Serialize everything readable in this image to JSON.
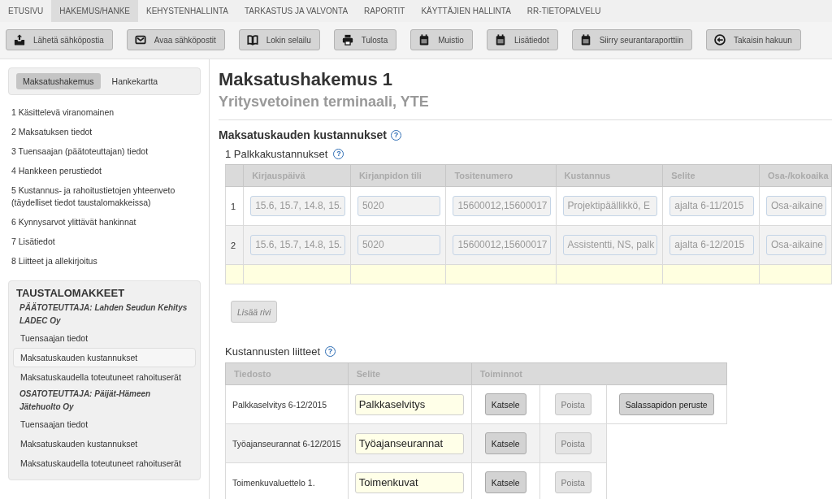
{
  "top_nav": [
    {
      "label": "ETUSIVU",
      "selected": false
    },
    {
      "label": "HAKEMUS/HANKE",
      "selected": true
    },
    {
      "label": "KEHYSTENHALLINTA",
      "selected": false
    },
    {
      "label": "TARKASTUS JA VALVONTA",
      "selected": false
    },
    {
      "label": "RAPORTIT",
      "selected": false
    },
    {
      "label": "KÄYTTÄJIEN HALLINTA",
      "selected": false
    },
    {
      "label": "RR-TIETOPALVELU",
      "selected": false
    }
  ],
  "toolbar": [
    {
      "label": "Lähetä sähköpostia",
      "kind": "send"
    },
    {
      "label": "Avaa sähköpostit",
      "kind": "mail"
    },
    {
      "label": "Lokin selailu",
      "kind": "book"
    },
    {
      "label": "Tulosta",
      "kind": "print"
    },
    {
      "label": "Muistio",
      "kind": "note"
    },
    {
      "label": "Lisätiedot",
      "kind": "note"
    },
    {
      "label": "Siirry seurantaraporttiin",
      "kind": "note"
    },
    {
      "label": "Takaisin hakuun",
      "kind": "back"
    }
  ],
  "sidebar": {
    "tabs": [
      {
        "label": "Maksatushakemus",
        "selected": true
      },
      {
        "label": "Hankekartta",
        "selected": false
      }
    ],
    "items": [
      "1 Käsittelevä viranomainen",
      "2 Maksatuksen tiedot",
      "3 Tuensaajan (päätoteuttajan) tiedot",
      "4 Hankkeen perustiedot",
      "5 Kustannus- ja rahoitustietojen yhteenveto (täydelliset tiedot taustalomakkeissa)",
      "6 Kynnysarvot ylittävät hankinnat",
      "7 Lisätiedot",
      "8 Liitteet ja allekirjoitus"
    ],
    "background_forms": {
      "title": "TAUSTALOMAKKEET",
      "groups": [
        {
          "heading": "PÄÄTOTEUTTAJA: Lahden Seudun Kehitys LADEC Oy",
          "items": [
            {
              "label": "Tuensaajan tiedot",
              "selected": false
            },
            {
              "label": "Maksatuskauden kustannukset",
              "selected": true
            },
            {
              "label": "Maksatuskaudella toteutuneet rahoituserät",
              "selected": false
            }
          ]
        },
        {
          "heading": "OSATOTEUTTAJA: Päijät-Hämeen Jätehuolto Oy",
          "items": [
            {
              "label": "Tuensaajan tiedot",
              "selected": false
            },
            {
              "label": "Maksatuskauden kustannukset",
              "selected": false
            },
            {
              "label": "Maksatuskaudella toteutuneet rahoituserät",
              "selected": false
            }
          ]
        }
      ]
    }
  },
  "main": {
    "title": "Maksatushakemus 1",
    "subtitle": "Yritysvetoinen terminaali, YTE",
    "costs": {
      "title": "Maksatuskauden kustannukset",
      "help_icon": "?",
      "subsection": {
        "title": "1 Palkkakustannukset",
        "help_icon": "?"
      },
      "table": {
        "columns": [
          "Kirjauspäivä",
          "Kirjanpidon tili",
          "Tositenumero",
          "Kustannus",
          "Selite",
          "Osa-/kokoaika"
        ],
        "rows": [
          {
            "kind": "entry",
            "number": "1",
            "disabled": true,
            "cells": [
              "15.6, 15.7, 14.8, 15.",
              "5020",
              "15600012,15600017",
              "Projektipäällikkö, E",
              "ajalta 6-11/2015",
              "Osa-aikaine"
            ]
          },
          {
            "kind": "entry",
            "number": "2",
            "disabled": true,
            "cells": [
              "15.6, 15.7, 14.8, 15.",
              "5020",
              "15600012,15600017",
              "Assistentti, NS, palk",
              "ajalta 6-12/2015",
              "Osa-aikaine"
            ]
          },
          {
            "kind": "new"
          }
        ]
      },
      "add_row_button": {
        "label": "Lisää rivi",
        "disabled": true
      }
    },
    "attachments": {
      "title": "Kustannusten liitteet",
      "help_icon": "?",
      "columns": [
        "Tiedosto",
        "Selite",
        "Toiminnot"
      ],
      "rows": [
        {
          "file": "Palkkaselvitys 6-12/2015",
          "description": "Palkkaselvitys",
          "view_button": "Katsele",
          "delete_button": {
            "label": "Poista",
            "disabled": true
          },
          "confidentiality_button": "Salassapidon peruste"
        },
        {
          "file": "Työajanseurannat 6-12/2015",
          "description": "Työajanseurannat",
          "view_button": "Katsele",
          "delete_button": {
            "label": "Poista",
            "disabled": true
          }
        },
        {
          "file": "Toimenkuvaluettelo 1.",
          "description": "Toimenkuvat",
          "view_button": "Katsele",
          "delete_button": {
            "label": "Poista",
            "disabled": true
          }
        }
      ]
    }
  }
}
